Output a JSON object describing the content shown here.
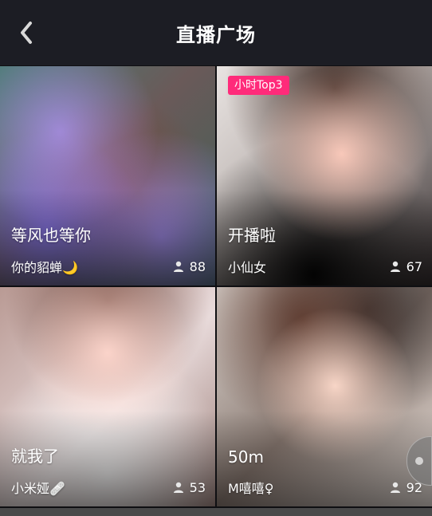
{
  "header": {
    "title": "直播广场"
  },
  "cards": [
    {
      "caption": "等风也等你",
      "author": "你的貂蝉🌙",
      "viewers": "88",
      "badge": ""
    },
    {
      "caption": "开播啦",
      "author": "小仙女",
      "viewers": "67",
      "badge": "小时Top3"
    },
    {
      "caption": "就我了",
      "author": "小米娅🩹",
      "viewers": "53",
      "badge": ""
    },
    {
      "caption": "50m",
      "author": "M嘻嘻♀",
      "viewers": "92",
      "badge": ""
    }
  ],
  "colors": {
    "topbar": "#1c1d24",
    "accent_badge": "#ff2b7a"
  },
  "icons": {
    "back": "chevron-left-icon",
    "viewer": "user-icon"
  }
}
